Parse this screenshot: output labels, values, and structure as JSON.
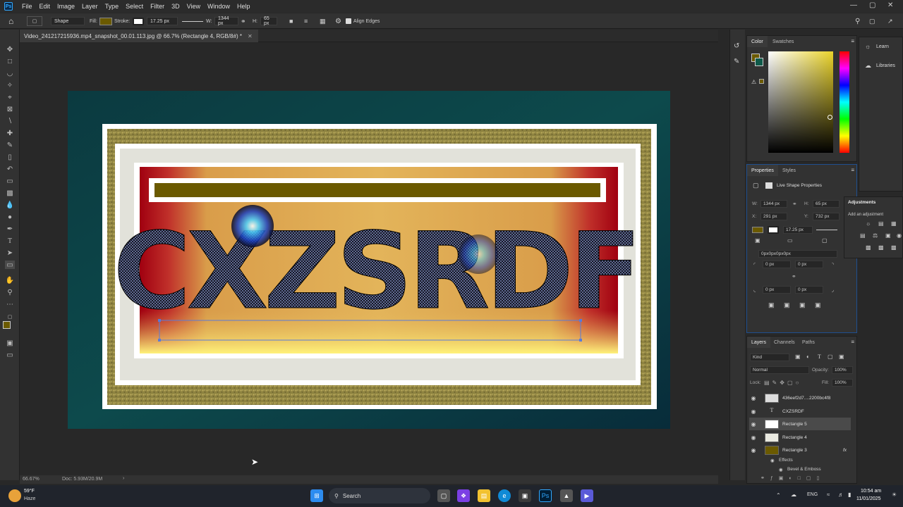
{
  "menubar": {
    "logo": "Ps",
    "items": [
      "File",
      "Edit",
      "Image",
      "Layer",
      "Type",
      "Select",
      "Filter",
      "3D",
      "View",
      "Window",
      "Help"
    ]
  },
  "options": {
    "mode": "Shape",
    "fill_label": "Fill:",
    "stroke_label": "Stroke:",
    "stroke_width": "17.25 px",
    "w_label": "W:",
    "w_value": "1344 px",
    "h_label": "H:",
    "h_value": "65 px",
    "align_edges": "Align Edges",
    "fill_color": "#6b5a00"
  },
  "document": {
    "tab_title": "Video_241217215936.mp4_snapshot_00.01.113.jpg @ 66.7% (Rectangle 4, RGB/8#) *",
    "canvas_text": "CXZSRDF",
    "zoom": "66.67%",
    "doc_size": "Doc: 5.93M/20.9M"
  },
  "color_panel": {
    "tabs": [
      "Color",
      "Swatches"
    ]
  },
  "learn": {
    "items": [
      "Learn",
      "Libraries"
    ]
  },
  "properties": {
    "tabs": [
      "Properties",
      "Styles"
    ],
    "section": "Live Shape Properties",
    "w_label": "W:",
    "w_value": "1344 px",
    "h_label": "H:",
    "h_value": "65 px",
    "x_label": "X:",
    "x_value": "291 px",
    "y_label": "Y:",
    "y_value": "732 px",
    "stroke": "17.25 px",
    "radii": "0px0px0px0px",
    "corner_tl": "0 px",
    "corner_tr": "0 px",
    "corner_bl": "0 px",
    "corner_br": "0 px"
  },
  "adjustments": {
    "title": "Adjustments",
    "subtitle": "Add an adjustment"
  },
  "layers": {
    "tabs": [
      "Layers",
      "Channels",
      "Paths"
    ],
    "kind": "Kind",
    "blend_mode": "Normal",
    "opacity_label": "Opacity:",
    "opacity": "100%",
    "lock_label": "Lock:",
    "fill_label": "Fill:",
    "fill": "100%",
    "items": [
      {
        "name": "436eef2d7....2200bc4f8",
        "type": "image"
      },
      {
        "name": "CXZSRDF",
        "type": "text"
      },
      {
        "name": "Rectangle 5",
        "type": "shape"
      },
      {
        "name": "Rectangle 4",
        "type": "shape"
      },
      {
        "name": "Rectangle 3",
        "type": "shape"
      }
    ],
    "effects_label": "Effects",
    "effect_item": "Bevel & Emboss",
    "fx": "fx"
  },
  "taskbar": {
    "weather_temp": "59°F",
    "weather_desc": "Haze",
    "search": "Search",
    "lang": "ENG",
    "time": "10:54 am",
    "date": "11/01/2025"
  }
}
